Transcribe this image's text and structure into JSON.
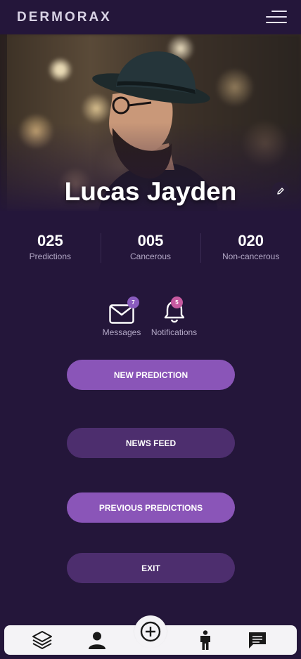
{
  "header": {
    "brand": "DERMORAX",
    "menu_icon": "hamburger-menu-icon"
  },
  "profile": {
    "name": "Lucas Jayden",
    "edit_icon": "pencil-icon"
  },
  "stats": [
    {
      "value": "025",
      "label": "Predictions"
    },
    {
      "value": "005",
      "label": "Cancerous"
    },
    {
      "value": "020",
      "label": "Non-cancerous"
    }
  ],
  "quick_actions": {
    "messages": {
      "label": "Messages",
      "badge": "7",
      "icon": "envelope-icon"
    },
    "notifications": {
      "label": "Notifications",
      "badge": "5",
      "icon": "bell-icon"
    }
  },
  "buttons": {
    "new_prediction": "NEW PREDICTION",
    "news_feed": "NEWS FEED",
    "previous_predictions": "PREVIOUS PREDICTIONS",
    "exit": "EXIT"
  },
  "bottom_nav": {
    "items": [
      "layers-icon",
      "user-icon",
      "add-circle-icon",
      "person-standing-icon",
      "chat-icon"
    ]
  },
  "colors": {
    "background": "#24163a",
    "button_primary": "#8a55b8",
    "button_secondary": "#4d2e6e",
    "badge_messages": "#8a5cbf",
    "badge_notifications": "#c75aa0"
  }
}
